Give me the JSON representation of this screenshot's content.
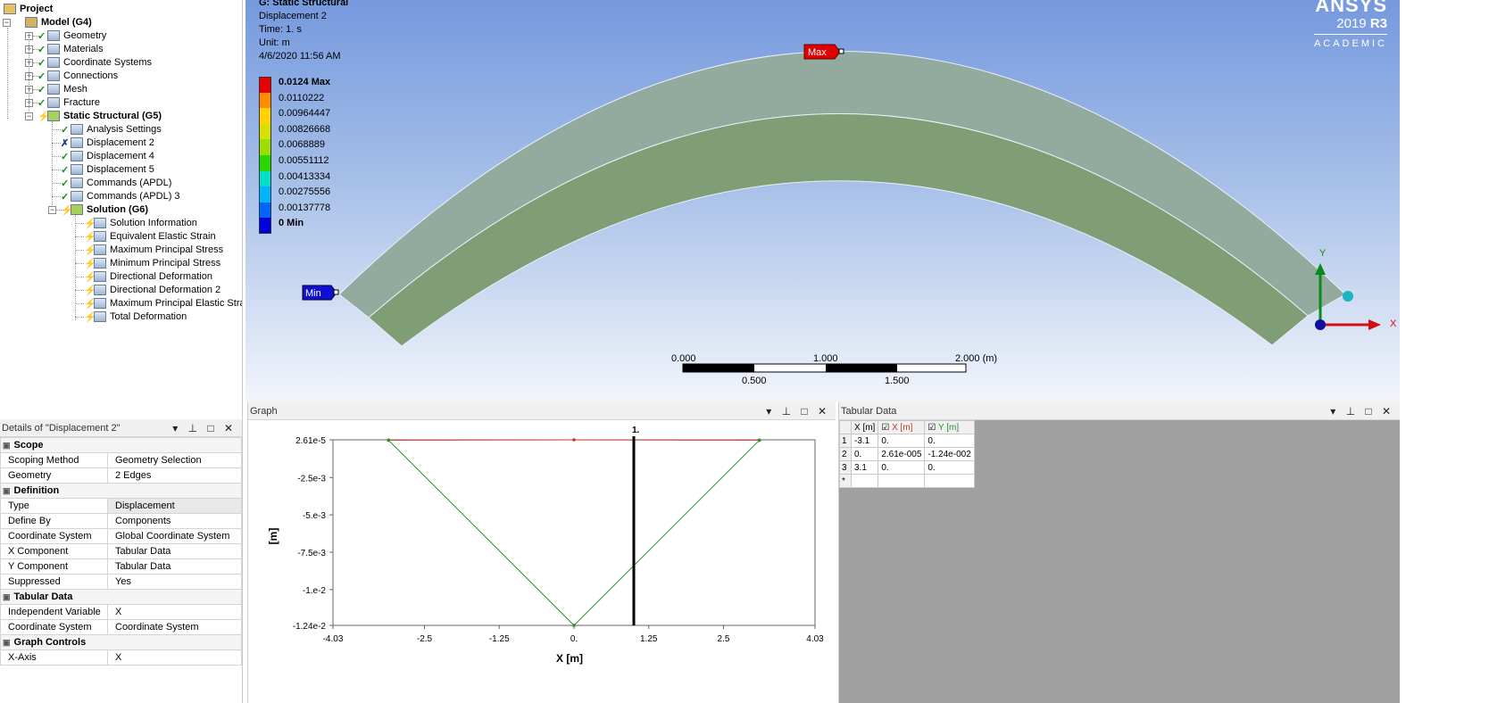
{
  "tree": {
    "project": "Project",
    "model": "Model (G4)",
    "items": [
      "Geometry",
      "Materials",
      "Coordinate Systems",
      "Connections",
      "Mesh",
      "Fracture"
    ],
    "static_structural": "Static Structural (G5)",
    "static_children": [
      "Analysis Settings",
      "Displacement 2",
      "Displacement 4",
      "Displacement 5",
      "Commands (APDL)",
      "Commands (APDL) 3"
    ],
    "solution": "Solution (G6)",
    "solution_children": [
      "Solution Information",
      "Equivalent Elastic Strain",
      "Maximum Principal Stress",
      "Minimum Principal Stress",
      "Directional Deformation",
      "Directional Deformation 2",
      "Maximum Principal Elastic Strain",
      "Total Deformation"
    ]
  },
  "details": {
    "title": "Details of \"Displacement 2\"",
    "rows": [
      {
        "section": "Scope"
      },
      {
        "k": "Scoping Method",
        "v": "Geometry Selection"
      },
      {
        "k": "Geometry",
        "v": "2 Edges"
      },
      {
        "section": "Definition"
      },
      {
        "k": "Type",
        "v": "Displacement"
      },
      {
        "k": "Define By",
        "v": "Components"
      },
      {
        "k": "Coordinate System",
        "v": "Global Coordinate System"
      },
      {
        "k": "X Component",
        "v": "Tabular Data"
      },
      {
        "k": "Y Component",
        "v": "Tabular Data"
      },
      {
        "k": "Suppressed",
        "v": "Yes"
      },
      {
        "section": "Tabular Data"
      },
      {
        "k": "Independent Variable",
        "v": "X"
      },
      {
        "k": "Coordinate System",
        "v": "Coordinate System"
      },
      {
        "section": "Graph Controls"
      },
      {
        "k": "X-Axis",
        "v": "X"
      }
    ]
  },
  "viewport": {
    "title": "G: Static Structural",
    "subtitle": "Displacement 2",
    "time": "Time: 1. s",
    "unit": "Unit: m",
    "date": "4/6/2020 11:56 AM",
    "legend": [
      {
        "label": "0.0124 Max",
        "color": "#e60000",
        "bold": true
      },
      {
        "label": "0.0110222",
        "color": "#ff8c00"
      },
      {
        "label": "0.00964447",
        "color": "#ffd200"
      },
      {
        "label": "0.00826668",
        "color": "#d8e000"
      },
      {
        "label": "0.0068889",
        "color": "#9adf00"
      },
      {
        "label": "0.00551112",
        "color": "#28d800"
      },
      {
        "label": "0.00413334",
        "color": "#00e0c8"
      },
      {
        "label": "0.00275556",
        "color": "#00b4ff"
      },
      {
        "label": "0.00137778",
        "color": "#0064ff"
      },
      {
        "label": "0 Min",
        "color": "#0000e0",
        "bold": true
      }
    ],
    "max_label": "Max",
    "min_label": "Min",
    "brand": "ANSYS",
    "version_year": "2019",
    "version_rel": "R3",
    "edition": "ACADEMIC",
    "axis_y": "Y",
    "axis_x": "X",
    "scale_top": [
      "0.000",
      "1.000",
      "2.000 (m)"
    ],
    "scale_bottom": [
      "0.500",
      "1.500"
    ],
    "colors": {
      "arch_light": "#93ab9e",
      "arch_dark": "#7f9e75"
    }
  },
  "graph": {
    "title": "Graph",
    "marker_label": "1.",
    "ylabel": "[m]",
    "xlabel": "X [m]",
    "ytick_labels": [
      "2.61e-5",
      "-2.5e-3",
      "-5.e-3",
      "-7.5e-3",
      "-1.e-2",
      "-1.24e-2"
    ],
    "xtick_labels": [
      "-4.03",
      "-2.5",
      "-1.25",
      "0.",
      "1.25",
      "2.5",
      "4.03"
    ]
  },
  "chart_data": {
    "type": "line",
    "xlabel": "X [m]",
    "ylabel": "[m]",
    "xlim": [
      -4.03,
      4.03
    ],
    "ylim": [
      -0.0124,
      2.61e-05
    ],
    "marker_x": 1,
    "x": [
      -3.1,
      0,
      3.1
    ],
    "series": [
      {
        "name": "X [m]",
        "color": "#c0392b",
        "values": [
          0,
          2.61e-05,
          0
        ]
      },
      {
        "name": "Y [m]",
        "color": "#2e8b2e",
        "values": [
          0,
          -0.0124,
          0
        ]
      }
    ]
  },
  "tabular": {
    "title": "Tabular Data",
    "headers": [
      "X [m]",
      "X [m]",
      "Y [m]"
    ],
    "rows": [
      [
        "1",
        "-3.1",
        "0.",
        "0."
      ],
      [
        "2",
        "0.",
        "2.61e-005",
        "-1.24e-002"
      ],
      [
        "3",
        "3.1",
        "0.",
        "0."
      ],
      [
        "*",
        "",
        "",
        ""
      ]
    ]
  }
}
